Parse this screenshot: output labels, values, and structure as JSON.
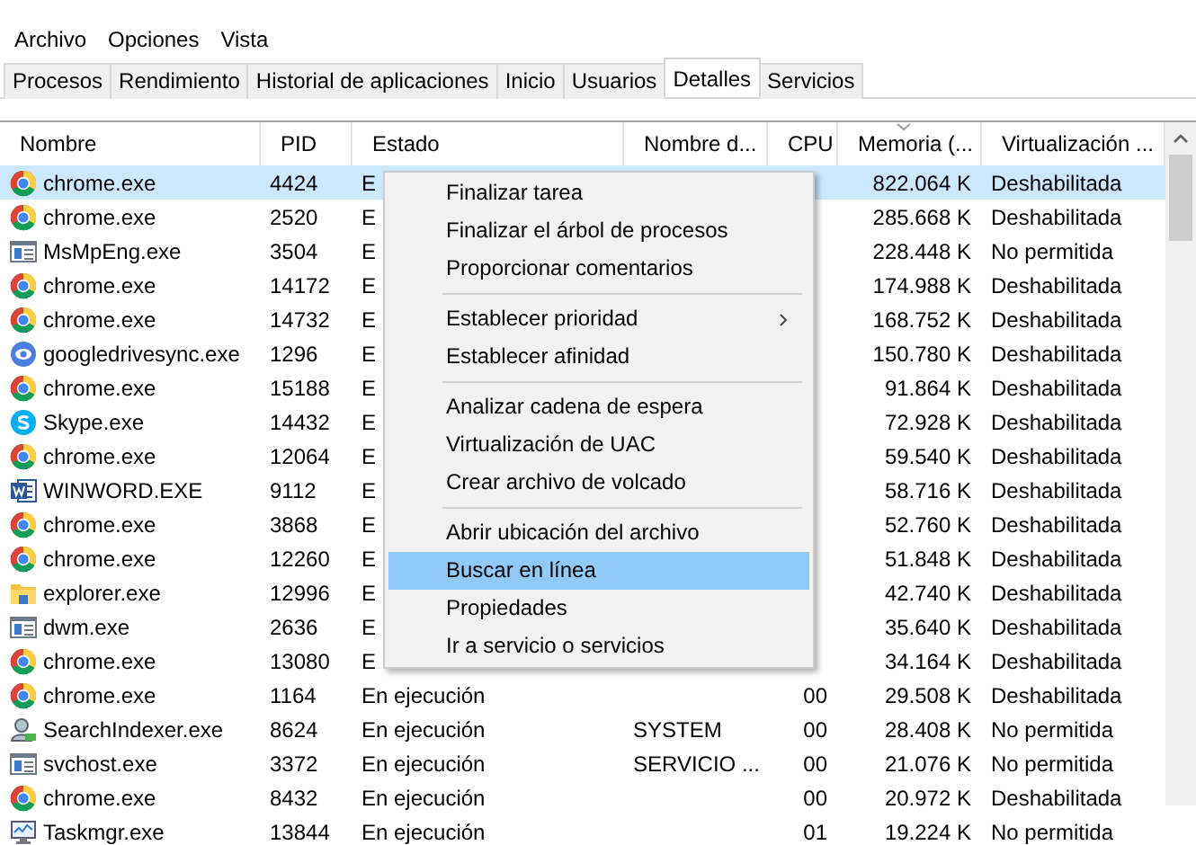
{
  "menu_bar": [
    "Archivo",
    "Opciones",
    "Vista"
  ],
  "tabs": [
    {
      "label": "Procesos",
      "selected": false
    },
    {
      "label": "Rendimiento",
      "selected": false
    },
    {
      "label": "Historial de aplicaciones",
      "selected": false
    },
    {
      "label": "Inicio",
      "selected": false
    },
    {
      "label": "Usuarios",
      "selected": false
    },
    {
      "label": "Detalles",
      "selected": true
    },
    {
      "label": "Servicios",
      "selected": false
    }
  ],
  "table": {
    "columns": [
      {
        "label": "Nombre",
        "sorted": false
      },
      {
        "label": "PID",
        "sorted": false
      },
      {
        "label": "Estado",
        "sorted": false
      },
      {
        "label": "Nombre d...",
        "sorted": false
      },
      {
        "label": "CPU",
        "sorted": false
      },
      {
        "label": "Memoria (...",
        "sorted": true
      },
      {
        "label": "Virtualización ...",
        "sorted": false
      }
    ],
    "rows": [
      {
        "kind": "chrome",
        "name": "chrome.exe",
        "pid": "4424",
        "state": "E",
        "memory": "822.064 K",
        "virtualization": "Deshabilitada",
        "selected": true
      },
      {
        "kind": "chrome",
        "name": "chrome.exe",
        "pid": "2520",
        "state": "E",
        "memory": "285.668 K",
        "virtualization": "Deshabilitada",
        "selected": false
      },
      {
        "kind": "window",
        "name": "MsMpEng.exe",
        "pid": "3504",
        "state": "E",
        "memory": "228.448 K",
        "virtualization": "No permitida",
        "selected": false
      },
      {
        "kind": "chrome",
        "name": "chrome.exe",
        "pid": "14172",
        "state": "E",
        "memory": "174.988 K",
        "virtualization": "Deshabilitada",
        "selected": false
      },
      {
        "kind": "chrome",
        "name": "chrome.exe",
        "pid": "14732",
        "state": "E",
        "memory": "168.752 K",
        "virtualization": "Deshabilitada",
        "selected": false
      },
      {
        "kind": "drive",
        "name": "googledrivesync.exe",
        "pid": "1296",
        "state": "E",
        "memory": "150.780 K",
        "virtualization": "Deshabilitada",
        "selected": false
      },
      {
        "kind": "chrome",
        "name": "chrome.exe",
        "pid": "15188",
        "state": "E",
        "memory": "91.864 K",
        "virtualization": "Deshabilitada",
        "selected": false
      },
      {
        "kind": "skype",
        "name": "Skype.exe",
        "pid": "14432",
        "state": "E",
        "memory": "72.928 K",
        "virtualization": "Deshabilitada",
        "selected": false
      },
      {
        "kind": "chrome",
        "name": "chrome.exe",
        "pid": "12064",
        "state": "E",
        "memory": "59.540 K",
        "virtualization": "Deshabilitada",
        "selected": false
      },
      {
        "kind": "word",
        "name": "WINWORD.EXE",
        "pid": "9112",
        "state": "E",
        "memory": "58.716 K",
        "virtualization": "Deshabilitada",
        "selected": false
      },
      {
        "kind": "chrome",
        "name": "chrome.exe",
        "pid": "3868",
        "state": "E",
        "memory": "52.760 K",
        "virtualization": "Deshabilitada",
        "selected": false
      },
      {
        "kind": "chrome",
        "name": "chrome.exe",
        "pid": "12260",
        "state": "E",
        "memory": "51.848 K",
        "virtualization": "Deshabilitada",
        "selected": false
      },
      {
        "kind": "folder",
        "name": "explorer.exe",
        "pid": "12996",
        "state": "E",
        "memory": "42.740 K",
        "virtualization": "Deshabilitada",
        "selected": false
      },
      {
        "kind": "window",
        "name": "dwm.exe",
        "pid": "2636",
        "state": "E",
        "memory": "35.640 K",
        "virtualization": "Deshabilitada",
        "selected": false
      },
      {
        "kind": "chrome",
        "name": "chrome.exe",
        "pid": "13080",
        "state": "E",
        "memory": "34.164 K",
        "virtualization": "Deshabilitada",
        "selected": false
      },
      {
        "kind": "chrome",
        "name": "chrome.exe",
        "pid": "1164",
        "state": "En ejecución",
        "cpu": "00",
        "memory": "29.508 K",
        "virtualization": "Deshabilitada",
        "selected": false
      },
      {
        "kind": "indexer",
        "name": "SearchIndexer.exe",
        "pid": "8624",
        "state": "En ejecución",
        "user": "SYSTEM",
        "cpu": "00",
        "memory": "28.408 K",
        "virtualization": "No permitida",
        "selected": false
      },
      {
        "kind": "window",
        "name": "svchost.exe",
        "pid": "3372",
        "state": "En ejecución",
        "user": "SERVICIO ...",
        "cpu": "00",
        "memory": "21.076 K",
        "virtualization": "No permitida",
        "selected": false
      },
      {
        "kind": "chrome",
        "name": "chrome.exe",
        "pid": "8432",
        "state": "En ejecución",
        "cpu": "00",
        "memory": "20.972 K",
        "virtualization": "Deshabilitada",
        "selected": false
      },
      {
        "kind": "monitor",
        "name": "Taskmgr.exe",
        "pid": "13844",
        "state": "En ejecución",
        "cpu": "01",
        "memory": "19.224 K",
        "virtualization": "No permitida",
        "selected": false
      }
    ]
  },
  "context_menu": [
    {
      "kind": "item",
      "label": "Finalizar tarea",
      "selected": false
    },
    {
      "kind": "item",
      "label": "Finalizar el árbol de procesos",
      "selected": false
    },
    {
      "kind": "item",
      "label": "Proporcionar comentarios",
      "selected": false
    },
    {
      "kind": "separator"
    },
    {
      "kind": "item",
      "label": "Establecer prioridad",
      "selected": false,
      "submenu": true
    },
    {
      "kind": "item",
      "label": "Establecer afinidad",
      "selected": false
    },
    {
      "kind": "separator"
    },
    {
      "kind": "item",
      "label": "Analizar cadena de espera",
      "selected": false
    },
    {
      "kind": "item",
      "label": "Virtualización de UAC",
      "selected": false
    },
    {
      "kind": "item",
      "label": "Crear archivo de volcado",
      "selected": false
    },
    {
      "kind": "separator"
    },
    {
      "kind": "item",
      "label": "Abrir ubicación del archivo",
      "selected": false
    },
    {
      "kind": "item",
      "label": "Buscar en línea",
      "selected": true
    },
    {
      "kind": "item",
      "label": "Propiedades",
      "selected": false
    },
    {
      "kind": "item",
      "label": "Ir a servicio o servicios",
      "selected": false
    }
  ]
}
